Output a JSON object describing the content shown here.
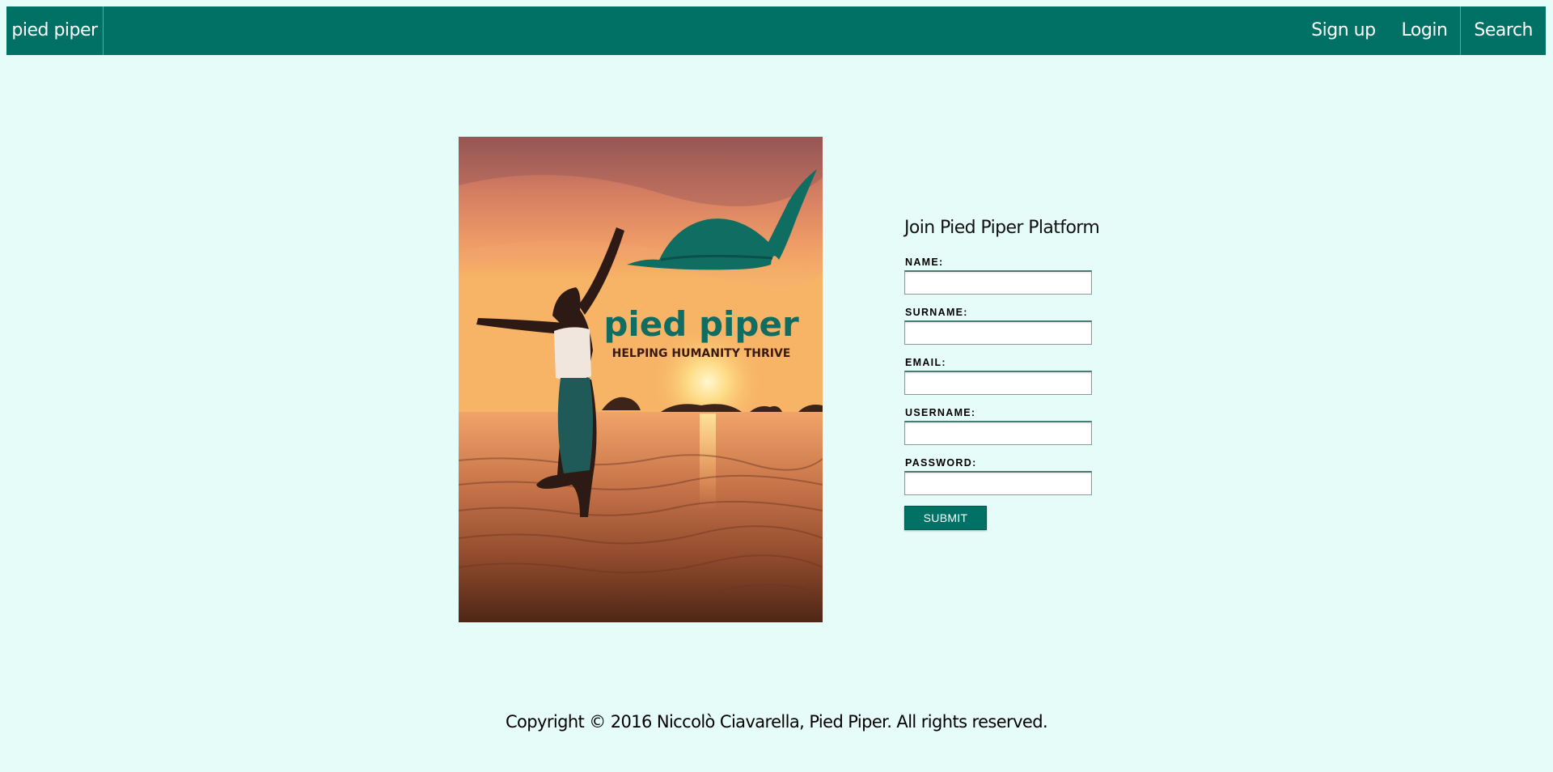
{
  "nav": {
    "brand": "pied piper",
    "links": [
      {
        "label": "Sign up"
      },
      {
        "label": "Login"
      }
    ],
    "search_label": "Search"
  },
  "hero": {
    "logo_text": "pied piper",
    "tagline": "HELPING HUMANITY THRIVE"
  },
  "form": {
    "title": "Join Pied Piper Platform",
    "fields": [
      {
        "label": "NAME:",
        "value": ""
      },
      {
        "label": "SURNAME:",
        "value": ""
      },
      {
        "label": "EMAIL:",
        "value": ""
      },
      {
        "label": "USERNAME:",
        "value": ""
      },
      {
        "label": "PASSWORD:",
        "value": ""
      }
    ],
    "submit_label": "SUBMIT"
  },
  "footer": {
    "copyright": "Copyright © 2016 Niccolò Ciavarella, Pied Piper. All rights reserved."
  },
  "colors": {
    "brand_green": "#007164",
    "page_background": "#e6fcf9"
  }
}
